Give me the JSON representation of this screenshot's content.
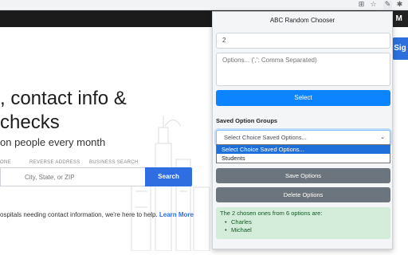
{
  "browser": {
    "icons": [
      "translate-icon",
      "star-icon",
      "extension-active-icon",
      "puzzle-icon"
    ]
  },
  "site": {
    "header_button": "am M",
    "sign_button": "Sig",
    "hero_line1": ", contact info &",
    "hero_line2": " checks",
    "hero_sub": "on people every month",
    "tabs": [
      "ONE",
      "REVERSE ADDRESS",
      "BUSINESS SEARCH"
    ],
    "search_placeholder": "City, State, or ZIP",
    "search_button": "Search",
    "bottom_text": "ospitals needing contact information, we're here to help. ",
    "bottom_link": "Learn More"
  },
  "popup": {
    "title": "ABC Random Chooser",
    "count_value": "2",
    "options_placeholder": "Options... (',': Comma Separated)",
    "select_button": "Select",
    "saved_label": "Saved Option Groups",
    "select_value": "Select Choice Saved Options...",
    "dropdown_options": [
      "Select Choice Saved Options...",
      "Students"
    ],
    "save_button": "Save Options",
    "delete_button": "Delete Options",
    "result_text": "The 2 chosen ones from 6 options are:",
    "chosen": [
      "Charles",
      "Michael"
    ],
    "colors": {
      "primary": "#0d84ff",
      "secondary": "#6c757d",
      "success_bg": "#d4edda"
    }
  }
}
